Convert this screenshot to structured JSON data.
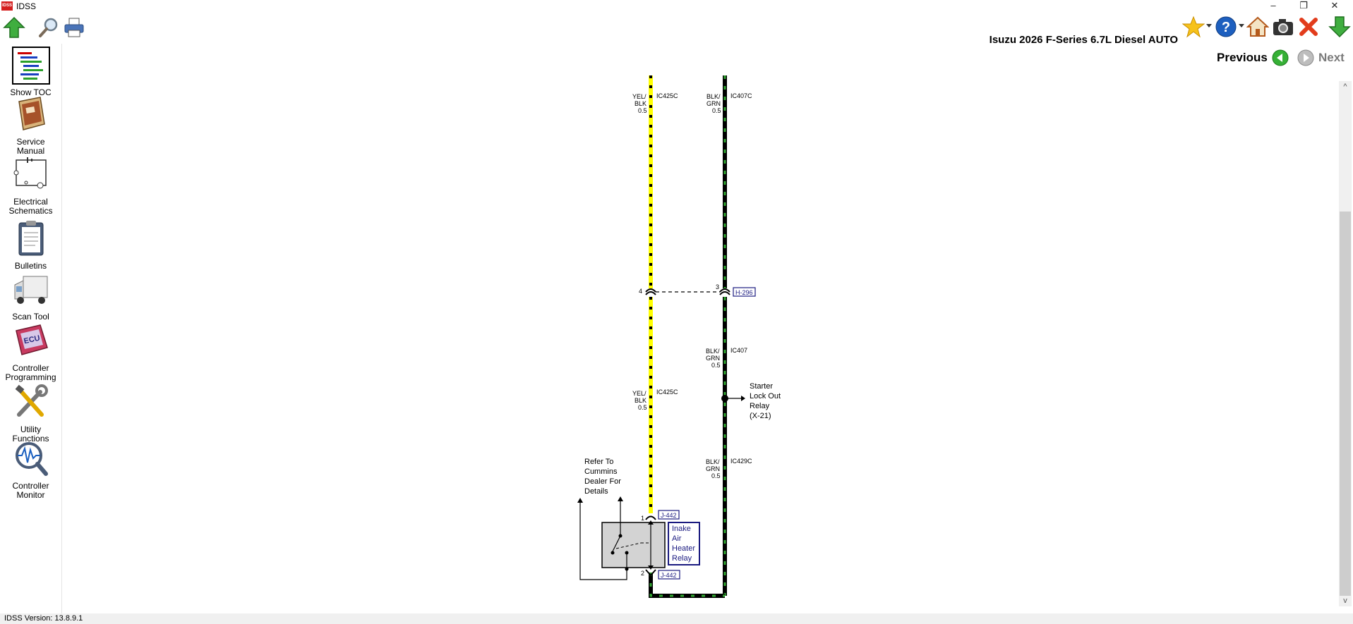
{
  "window": {
    "title": "IDSS",
    "logo_text": "IDSS",
    "min": "–",
    "restore": "❐",
    "close": "✕"
  },
  "toolbar": {
    "vehicle": "Isuzu 2026 F-Series 6.7L Diesel AUTO"
  },
  "sidebar": {
    "items": [
      {
        "label1": "Show TOC",
        "label2": ""
      },
      {
        "label1": "Service",
        "label2": "Manual"
      },
      {
        "label1": "Electrical",
        "label2": "Schematics"
      },
      {
        "label1": "Bulletins",
        "label2": ""
      },
      {
        "label1": "Scan Tool",
        "label2": ""
      },
      {
        "label1": "Controller",
        "label2": "Programming"
      },
      {
        "label1": "Utility",
        "label2": "Functions"
      },
      {
        "label1": "Controller",
        "label2": "Monitor"
      }
    ]
  },
  "nav": {
    "previous": "Previous",
    "next": "Next"
  },
  "schematic": {
    "wire_left_top": {
      "color1": "YEL/",
      "color2": "BLK",
      "size": "0.5",
      "circuit": "IC425C"
    },
    "wire_right_top": {
      "color1": "BLK/",
      "color2": "GRN",
      "size": "0.5",
      "circuit": "IC407C"
    },
    "pin_left": "4",
    "pin_right": "3",
    "connector_h": "H-296",
    "wire_right_mid": {
      "color1": "BLK/",
      "color2": "GRN",
      "size": "0.5",
      "circuit": "IC407"
    },
    "starter": {
      "l1": "Starter",
      "l2": "Lock Out",
      "l3": "Relay",
      "l4": "(X-21)"
    },
    "wire_left_mid": {
      "color1": "YEL/",
      "color2": "BLK",
      "size": "0.5",
      "circuit": "IC425C"
    },
    "wire_right_low": {
      "color1": "BLK/",
      "color2": "GRN",
      "size": "0.5",
      "circuit": "IC429C"
    },
    "refer": {
      "l1": "Refer To",
      "l2": "Cummins",
      "l3": "Dealer For",
      "l4": "Details"
    },
    "pin1": "1",
    "pin2": "2",
    "connector_j_top": "J-442",
    "connector_j_bot": "J-442",
    "relay": {
      "l1": "Inake",
      "l2": "Air",
      "l3": "Heater",
      "l4": "Relay"
    }
  },
  "status": {
    "version": "IDSS Version: 13.8.9.1"
  }
}
